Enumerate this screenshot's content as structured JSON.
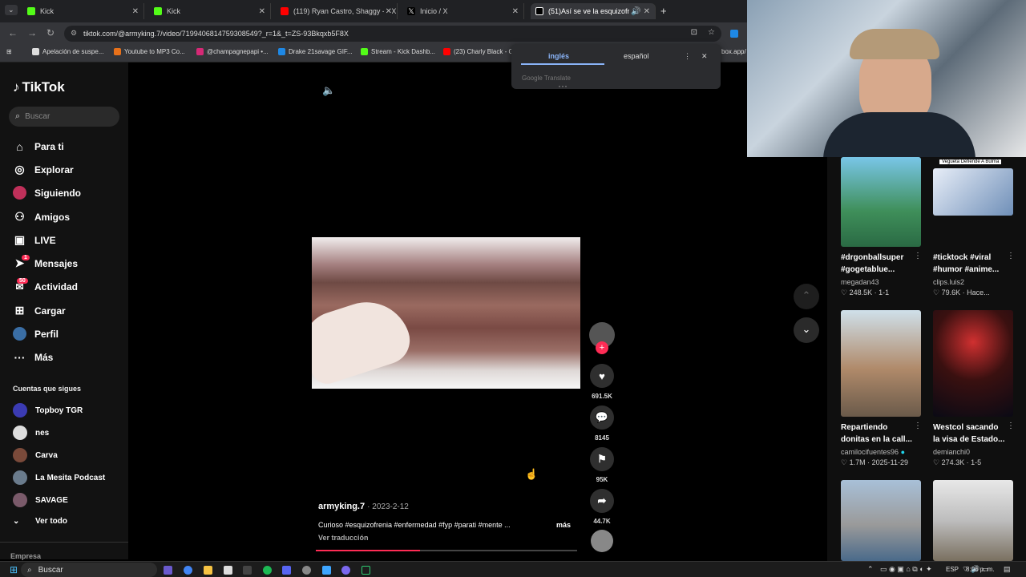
{
  "browser": {
    "tabs": [
      {
        "label": "Kick",
        "color": "#53fc18"
      },
      {
        "label": "Kick",
        "color": "#53fc18"
      },
      {
        "label": "(119) Ryan Castro, Shaggy - EX",
        "color": "#ff0000"
      },
      {
        "label": "Inicio / X",
        "color": "#ffffff"
      },
      {
        "label": "(51)Así se ve la esquizofren",
        "color": "#ffffff"
      }
    ],
    "new_tab": "+",
    "url": "tiktok.com/@armyking.7/video/7199406814759308549?_r=1&_t=ZS-93Bkqxb5F8X",
    "bookmarks": [
      {
        "label": "Apelación de suspe...",
        "color": "#dddddd"
      },
      {
        "label": "Youtube to MP3 Co...",
        "color": "#e8711a"
      },
      {
        "label": "@champagnepapi •...",
        "color": "#d62976"
      },
      {
        "label": "Drake 21savage GIF...",
        "color": "#1e88e5"
      },
      {
        "label": "Stream - Kick Dashb...",
        "color": "#53fc18"
      },
      {
        "label": "(23) Charly Black - G",
        "color": "#ff0000"
      },
      {
        "label": "box.app/",
        "color": "#888888"
      }
    ]
  },
  "translate": {
    "lang_from": "inglés",
    "lang_to": "español",
    "footer": "Google Translate"
  },
  "sidebar": {
    "logo": "TikTok",
    "search_placeholder": "Buscar",
    "nav": [
      {
        "label": "Para ti",
        "icon": "home-icon",
        "glyph": "⌂"
      },
      {
        "label": "Explorar",
        "icon": "compass-icon",
        "glyph": "◎"
      },
      {
        "label": "Siguiendo",
        "icon": "following-avatar-icon",
        "glyph": "●"
      },
      {
        "label": "Amigos",
        "icon": "friends-icon",
        "glyph": "⚇"
      },
      {
        "label": "LIVE",
        "icon": "live-icon",
        "glyph": "▣"
      },
      {
        "label": "Mensajes",
        "icon": "send-icon",
        "glyph": "➤"
      },
      {
        "label": "Actividad",
        "icon": "activity-icon",
        "glyph": "●"
      },
      {
        "label": "Cargar",
        "icon": "upload-icon",
        "glyph": "⊞"
      },
      {
        "label": "Perfil",
        "icon": "profile-icon",
        "glyph": "●"
      },
      {
        "label": "Más",
        "icon": "more-icon",
        "glyph": "···"
      }
    ],
    "messages_badge": "1",
    "activity_badge": "50",
    "following_title": "Cuentas que sigues",
    "following": [
      {
        "name": "Topboy TGR",
        "color": "#3b3bb3"
      },
      {
        "name": "nes",
        "color": "#dddddd"
      },
      {
        "name": "Carva",
        "color": "#7a4a3a"
      },
      {
        "name": "La Mesita Podcast",
        "color": "#6a7b8c"
      },
      {
        "name": "SAVAGE",
        "color": "#7a5a6a"
      }
    ],
    "see_all": "Ver todo",
    "company": "Empresa"
  },
  "video": {
    "username": "armyking.7",
    "date": "2023-2-12",
    "caption": "Curioso #esquizofrenia #enfermedad #fyp #parati #mente ...",
    "more": "más",
    "translate_link": "Ver traducción",
    "progress": 0.4
  },
  "actions": {
    "likes": "691.5K",
    "comments": "8145",
    "saves": "95K",
    "shares": "44.7K"
  },
  "recommended": [
    {
      "title": "#drgonballsuper #gogetablue...",
      "author": "megadan43",
      "stats": "248.5K · 1-1",
      "thumb": "#3f8f5a"
    },
    {
      "title": "#ticktock #viral #humor #anime...",
      "author": "clips.luis2",
      "stats": "79.6K · Hace...",
      "thumb": "#6f8fb8",
      "overlay": "Vegueta Defiende A Bulma"
    },
    {
      "title": "Repartiendo donitas en la call...",
      "author": "camilocifuentes96",
      "stats": "1.7M · 2025-11-29",
      "thumb": "#b08a6a"
    },
    {
      "title": "Westcol sacando la visa de Estado...",
      "author": "demianchi0",
      "stats": "274.3K · 1-5",
      "thumb": "#3a1010"
    },
    {
      "title": "",
      "author": "",
      "stats": "",
      "thumb": "#9a9a9a"
    },
    {
      "title": "",
      "author": "",
      "stats": "",
      "thumb": "#bdbdbd"
    }
  ],
  "taskbar": {
    "search": "Buscar",
    "lang": "ESP",
    "time": "8:06 p. m."
  }
}
